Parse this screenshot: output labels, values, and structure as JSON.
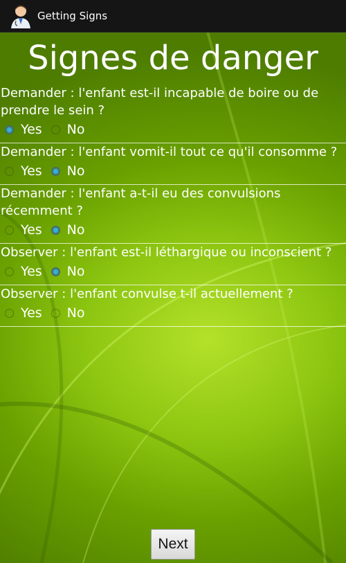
{
  "app": {
    "title": "Getting Signs",
    "icon": "doctor-avatar-icon"
  },
  "page": {
    "title": "Signes de danger"
  },
  "questions": [
    {
      "text": "Demander : l'enfant est-il incapable de boire ou de prendre le sein ?",
      "yes_label": "Yes",
      "no_label": "No",
      "selected": "yes"
    },
    {
      "text": "Demander : l'enfant vomit-il tout ce qu'il consomme ?",
      "yes_label": "Yes",
      "no_label": "No",
      "selected": "no"
    },
    {
      "text": "Demander : l'enfant a-t-il eu des convulsions récemment ?",
      "yes_label": "Yes",
      "no_label": "No",
      "selected": "no"
    },
    {
      "text": "Observer : l'enfant est-il léthargique ou inconscient ?",
      "yes_label": "Yes",
      "no_label": "No",
      "selected": "no"
    },
    {
      "text": "Observer : l'enfant convulse t-il actuellement ?",
      "yes_label": "Yes",
      "no_label": "No",
      "selected": "none"
    }
  ],
  "next_label": "Next",
  "colors": {
    "action_bar": "#151515",
    "background": "#8cc510",
    "radio_checked": "#35b0d8"
  }
}
